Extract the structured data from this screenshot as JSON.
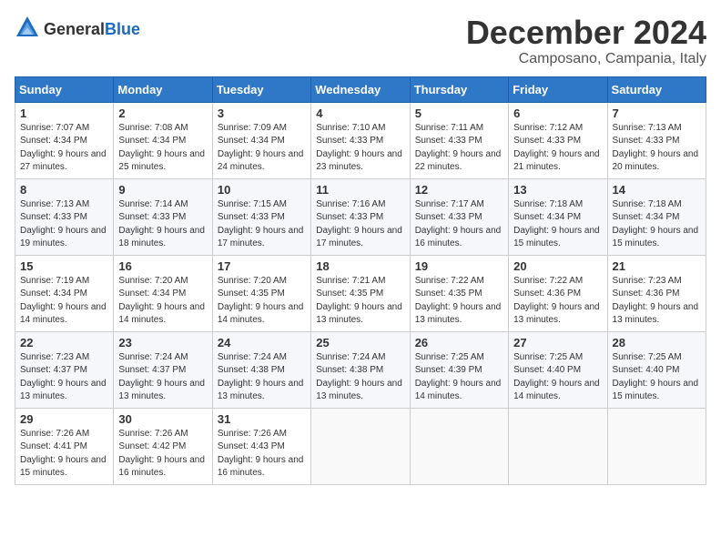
{
  "header": {
    "logo_general": "General",
    "logo_blue": "Blue",
    "month_title": "December 2024",
    "location": "Camposano, Campania, Italy"
  },
  "columns": [
    "Sunday",
    "Monday",
    "Tuesday",
    "Wednesday",
    "Thursday",
    "Friday",
    "Saturday"
  ],
  "weeks": [
    [
      {
        "day": "1",
        "sunrise": "Sunrise: 7:07 AM",
        "sunset": "Sunset: 4:34 PM",
        "daylight": "Daylight: 9 hours and 27 minutes."
      },
      {
        "day": "2",
        "sunrise": "Sunrise: 7:08 AM",
        "sunset": "Sunset: 4:34 PM",
        "daylight": "Daylight: 9 hours and 25 minutes."
      },
      {
        "day": "3",
        "sunrise": "Sunrise: 7:09 AM",
        "sunset": "Sunset: 4:34 PM",
        "daylight": "Daylight: 9 hours and 24 minutes."
      },
      {
        "day": "4",
        "sunrise": "Sunrise: 7:10 AM",
        "sunset": "Sunset: 4:33 PM",
        "daylight": "Daylight: 9 hours and 23 minutes."
      },
      {
        "day": "5",
        "sunrise": "Sunrise: 7:11 AM",
        "sunset": "Sunset: 4:33 PM",
        "daylight": "Daylight: 9 hours and 22 minutes."
      },
      {
        "day": "6",
        "sunrise": "Sunrise: 7:12 AM",
        "sunset": "Sunset: 4:33 PM",
        "daylight": "Daylight: 9 hours and 21 minutes."
      },
      {
        "day": "7",
        "sunrise": "Sunrise: 7:13 AM",
        "sunset": "Sunset: 4:33 PM",
        "daylight": "Daylight: 9 hours and 20 minutes."
      }
    ],
    [
      {
        "day": "8",
        "sunrise": "Sunrise: 7:13 AM",
        "sunset": "Sunset: 4:33 PM",
        "daylight": "Daylight: 9 hours and 19 minutes."
      },
      {
        "day": "9",
        "sunrise": "Sunrise: 7:14 AM",
        "sunset": "Sunset: 4:33 PM",
        "daylight": "Daylight: 9 hours and 18 minutes."
      },
      {
        "day": "10",
        "sunrise": "Sunrise: 7:15 AM",
        "sunset": "Sunset: 4:33 PM",
        "daylight": "Daylight: 9 hours and 17 minutes."
      },
      {
        "day": "11",
        "sunrise": "Sunrise: 7:16 AM",
        "sunset": "Sunset: 4:33 PM",
        "daylight": "Daylight: 9 hours and 17 minutes."
      },
      {
        "day": "12",
        "sunrise": "Sunrise: 7:17 AM",
        "sunset": "Sunset: 4:33 PM",
        "daylight": "Daylight: 9 hours and 16 minutes."
      },
      {
        "day": "13",
        "sunrise": "Sunrise: 7:18 AM",
        "sunset": "Sunset: 4:34 PM",
        "daylight": "Daylight: 9 hours and 15 minutes."
      },
      {
        "day": "14",
        "sunrise": "Sunrise: 7:18 AM",
        "sunset": "Sunset: 4:34 PM",
        "daylight": "Daylight: 9 hours and 15 minutes."
      }
    ],
    [
      {
        "day": "15",
        "sunrise": "Sunrise: 7:19 AM",
        "sunset": "Sunset: 4:34 PM",
        "daylight": "Daylight: 9 hours and 14 minutes."
      },
      {
        "day": "16",
        "sunrise": "Sunrise: 7:20 AM",
        "sunset": "Sunset: 4:34 PM",
        "daylight": "Daylight: 9 hours and 14 minutes."
      },
      {
        "day": "17",
        "sunrise": "Sunrise: 7:20 AM",
        "sunset": "Sunset: 4:35 PM",
        "daylight": "Daylight: 9 hours and 14 minutes."
      },
      {
        "day": "18",
        "sunrise": "Sunrise: 7:21 AM",
        "sunset": "Sunset: 4:35 PM",
        "daylight": "Daylight: 9 hours and 13 minutes."
      },
      {
        "day": "19",
        "sunrise": "Sunrise: 7:22 AM",
        "sunset": "Sunset: 4:35 PM",
        "daylight": "Daylight: 9 hours and 13 minutes."
      },
      {
        "day": "20",
        "sunrise": "Sunrise: 7:22 AM",
        "sunset": "Sunset: 4:36 PM",
        "daylight": "Daylight: 9 hours and 13 minutes."
      },
      {
        "day": "21",
        "sunrise": "Sunrise: 7:23 AM",
        "sunset": "Sunset: 4:36 PM",
        "daylight": "Daylight: 9 hours and 13 minutes."
      }
    ],
    [
      {
        "day": "22",
        "sunrise": "Sunrise: 7:23 AM",
        "sunset": "Sunset: 4:37 PM",
        "daylight": "Daylight: 9 hours and 13 minutes."
      },
      {
        "day": "23",
        "sunrise": "Sunrise: 7:24 AM",
        "sunset": "Sunset: 4:37 PM",
        "daylight": "Daylight: 9 hours and 13 minutes."
      },
      {
        "day": "24",
        "sunrise": "Sunrise: 7:24 AM",
        "sunset": "Sunset: 4:38 PM",
        "daylight": "Daylight: 9 hours and 13 minutes."
      },
      {
        "day": "25",
        "sunrise": "Sunrise: 7:24 AM",
        "sunset": "Sunset: 4:38 PM",
        "daylight": "Daylight: 9 hours and 13 minutes."
      },
      {
        "day": "26",
        "sunrise": "Sunrise: 7:25 AM",
        "sunset": "Sunset: 4:39 PM",
        "daylight": "Daylight: 9 hours and 14 minutes."
      },
      {
        "day": "27",
        "sunrise": "Sunrise: 7:25 AM",
        "sunset": "Sunset: 4:40 PM",
        "daylight": "Daylight: 9 hours and 14 minutes."
      },
      {
        "day": "28",
        "sunrise": "Sunrise: 7:25 AM",
        "sunset": "Sunset: 4:40 PM",
        "daylight": "Daylight: 9 hours and 15 minutes."
      }
    ],
    [
      {
        "day": "29",
        "sunrise": "Sunrise: 7:26 AM",
        "sunset": "Sunset: 4:41 PM",
        "daylight": "Daylight: 9 hours and 15 minutes."
      },
      {
        "day": "30",
        "sunrise": "Sunrise: 7:26 AM",
        "sunset": "Sunset: 4:42 PM",
        "daylight": "Daylight: 9 hours and 16 minutes."
      },
      {
        "day": "31",
        "sunrise": "Sunrise: 7:26 AM",
        "sunset": "Sunset: 4:43 PM",
        "daylight": "Daylight: 9 hours and 16 minutes."
      },
      null,
      null,
      null,
      null
    ]
  ]
}
